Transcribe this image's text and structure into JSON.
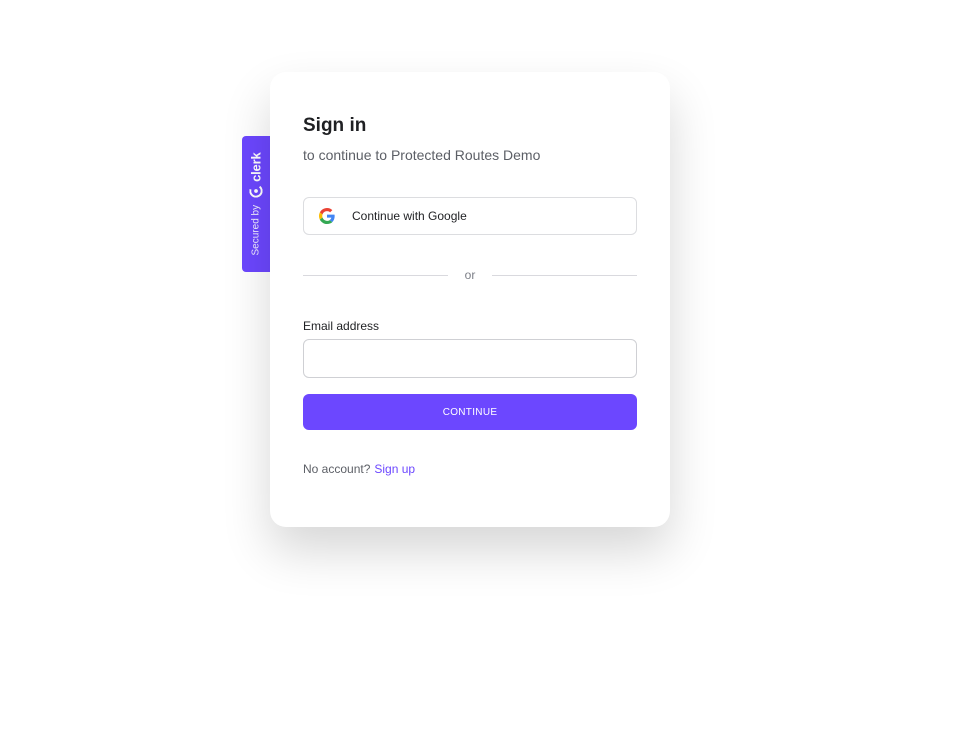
{
  "colors": {
    "accent": "#6c47ff",
    "text_primary": "#1f2023",
    "text_secondary": "#5c5f66"
  },
  "secured_badge": {
    "prefix": "Secured by",
    "brand": "clerk",
    "icon": "clerk-logo-icon"
  },
  "card": {
    "title": "Sign in",
    "subtitle": "to continue to Protected Routes Demo"
  },
  "social": {
    "google_label": "Continue with Google",
    "icon": "google-icon"
  },
  "divider": {
    "text": "or"
  },
  "form": {
    "email_label": "Email address",
    "email_value": "",
    "continue_label": "CONTINUE"
  },
  "footer": {
    "prompt": "No account?",
    "signup_label": "Sign up"
  }
}
